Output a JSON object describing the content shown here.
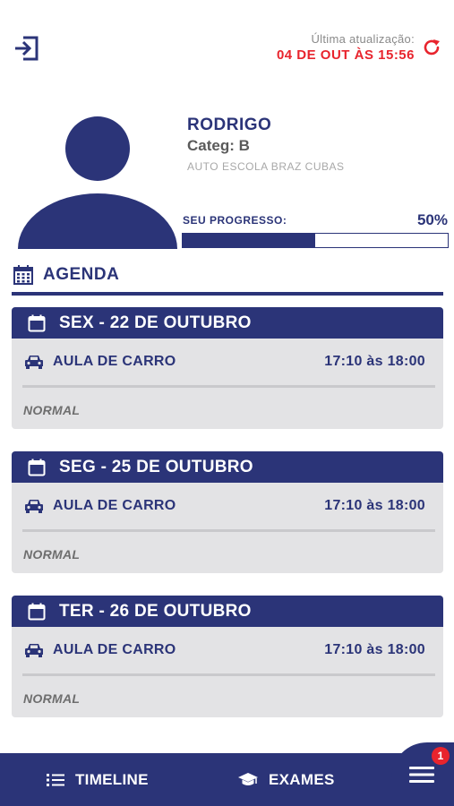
{
  "header": {
    "last_update_label": "Última atualização:",
    "last_update_value": "04 DE OUT ÀS 15:56"
  },
  "profile": {
    "name": "RODRIGO",
    "category": "Categ: B",
    "school": "AUTO ESCOLA BRAZ CUBAS"
  },
  "progress": {
    "label": "SEU PROGRESSO:",
    "value_text": "50%",
    "value": 0.5
  },
  "agenda": {
    "title": "AGENDA",
    "items": [
      {
        "date": "SEX - 22 DE OUTUBRO",
        "lesson": "AULA DE CARRO",
        "time": "17:10 às 18:00",
        "status": "NORMAL"
      },
      {
        "date": "SEG - 25 DE OUTUBRO",
        "lesson": "AULA DE CARRO",
        "time": "17:10 às 18:00",
        "status": "NORMAL"
      },
      {
        "date": "TER - 26 DE OUTUBRO",
        "lesson": "AULA DE CARRO",
        "time": "17:10 às 18:00",
        "status": "NORMAL"
      }
    ]
  },
  "nav": {
    "timeline_label": "TIMELINE",
    "exams_label": "EXAMES",
    "menu_badge": "1"
  },
  "colors": {
    "primary": "#2b3478",
    "accent_red": "#e8242d",
    "card_bg": "#e3e3e5"
  },
  "icons": [
    "logout-icon",
    "refresh-icon",
    "avatar-icon",
    "calendar-icon",
    "car-icon",
    "list-icon",
    "graduation-cap-icon",
    "hamburger-menu-icon"
  ]
}
